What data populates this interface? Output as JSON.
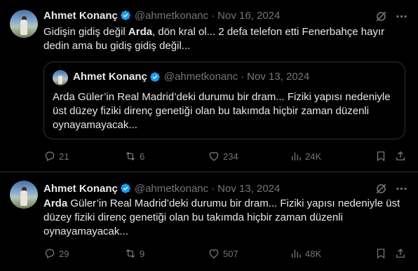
{
  "colors": {
    "background": "#000000",
    "text": "#e7e9ea",
    "muted": "#71767b",
    "border": "#2f3336",
    "verified": "#1d9bf0"
  },
  "tweets": [
    {
      "author": {
        "name": "Ahmet Konanç",
        "handle": "@ahmetkonanc",
        "avatar_icon": "avatar-photo"
      },
      "date": "Nov 16, 2024",
      "text_bold": "Arda",
      "text_before": "Gidişin gidiş değil ",
      "text_after": ", dön kral ol... 2 defa telefon etti Fenerbahçe hayır dedin ama bu gidiş gidiş değil...",
      "quote": {
        "author": {
          "name": "Ahmet Konanç",
          "handle": "@ahmetkonanc"
        },
        "date": "Nov 13, 2024",
        "text": "Arda Güler’in Real Madrid’deki durumu bir dram... Fiziki yapısı nedeniyle üst düzey fiziki direnç genetiği olan bu takımda hiçbir zaman düzenli oynayamayacak..."
      },
      "stats": {
        "replies": "21",
        "reposts": "6",
        "likes": "234",
        "views": "24K"
      }
    },
    {
      "author": {
        "name": "Ahmet Konanç",
        "handle": "@ahmetkonanc",
        "avatar_icon": "avatar-photo"
      },
      "date": "Nov 13, 2024",
      "text_bold": "Arda",
      "text_before": "",
      "text_after": " Güler’in Real Madrid’deki durumu bir dram... Fiziki yapısı nedeniyle üst düzey fiziki direnç genetiği olan bu takımda hiçbir zaman düzenli oynayamayacak...",
      "stats": {
        "replies": "29",
        "reposts": "9",
        "likes": "507",
        "views": "48K"
      }
    }
  ],
  "icons": {
    "grok": "grok-icon",
    "more": "more-icon",
    "reply": "reply-icon",
    "repost": "repost-icon",
    "like": "like-icon",
    "views": "views-icon",
    "bookmark": "bookmark-icon",
    "share": "share-icon",
    "verified": "verified-badge-icon"
  }
}
